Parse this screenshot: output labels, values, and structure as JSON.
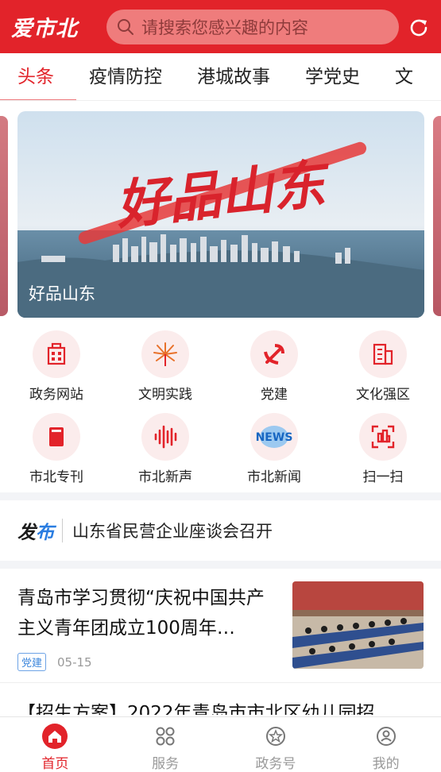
{
  "header": {
    "logo": "爱市北",
    "search_placeholder": "请搜索您感兴趣的内容",
    "brand_color": "#e2232a"
  },
  "tabs": [
    {
      "label": "头条",
      "active": true
    },
    {
      "label": "疫情防控",
      "active": false
    },
    {
      "label": "港城故事",
      "active": false
    },
    {
      "label": "学党史",
      "active": false
    },
    {
      "label": "文",
      "active": false
    }
  ],
  "banner": {
    "caption": "好品山东"
  },
  "grid": [
    {
      "label": "政务网站",
      "icon": "building-icon"
    },
    {
      "label": "文明实践",
      "icon": "flower-icon"
    },
    {
      "label": "党建",
      "icon": "party-emblem-icon"
    },
    {
      "label": "文化强区",
      "icon": "city-icon"
    },
    {
      "label": "市北专刊",
      "icon": "book-icon"
    },
    {
      "label": "市北新声",
      "icon": "soundwave-icon"
    },
    {
      "label": "市北新闻",
      "icon": "news-icon"
    },
    {
      "label": "扫一扫",
      "icon": "scan-icon"
    }
  ],
  "notice": {
    "brand_a": "发",
    "brand_b": "布",
    "text": "山东省民营企业座谈会召开"
  },
  "article": {
    "title": "青岛市学习贯彻“庆祝中国共产主义青年团成立100周年…",
    "tag": "党建",
    "date": "05-15"
  },
  "article2": {
    "title": "【招生方案】2022年青岛市市北区幼儿园招"
  },
  "bottom_nav": [
    {
      "label": "首页",
      "icon": "home-icon",
      "active": true
    },
    {
      "label": "服务",
      "icon": "grid-icon",
      "active": false
    },
    {
      "label": "政务号",
      "icon": "badge-icon",
      "active": false
    },
    {
      "label": "我的",
      "icon": "user-icon",
      "active": false
    }
  ]
}
